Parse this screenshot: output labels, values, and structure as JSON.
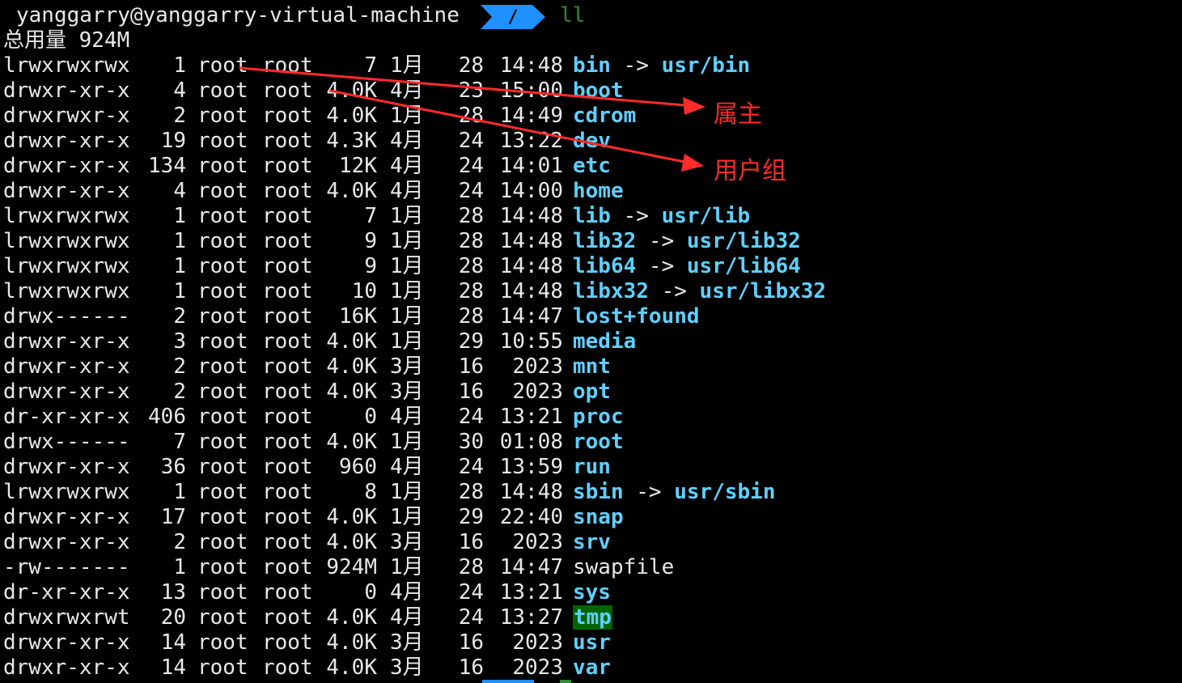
{
  "prompt": {
    "user_host": "yanggarry@yanggarry-virtual-machine",
    "cwd": "/",
    "command": "ll"
  },
  "total_line": "总用量 924M",
  "rows": [
    {
      "perm": "lrwxrwxrwx",
      "links": "1",
      "owner": "root",
      "group": "root",
      "size": "7",
      "month": "1月",
      "day": "28",
      "time": "14:48",
      "name": "bin",
      "target": "usr/bin",
      "style": "bold"
    },
    {
      "perm": "drwxr-xr-x",
      "links": "4",
      "owner": "root",
      "group": "root",
      "size": "4.0K",
      "month": "4月",
      "day": "23",
      "time": "15:00",
      "name": "boot",
      "target": "",
      "style": "bold"
    },
    {
      "perm": "drwxrwxr-x",
      "links": "2",
      "owner": "root",
      "group": "root",
      "size": "4.0K",
      "month": "1月",
      "day": "28",
      "time": "14:49",
      "name": "cdrom",
      "target": "",
      "style": "bold"
    },
    {
      "perm": "drwxr-xr-x",
      "links": "19",
      "owner": "root",
      "group": "root",
      "size": "4.3K",
      "month": "4月",
      "day": "24",
      "time": "13:22",
      "name": "dev",
      "target": "",
      "style": "bold"
    },
    {
      "perm": "drwxr-xr-x",
      "links": "134",
      "owner": "root",
      "group": "root",
      "size": "12K",
      "month": "4月",
      "day": "24",
      "time": "14:01",
      "name": "etc",
      "target": "",
      "style": "bold"
    },
    {
      "perm": "drwxr-xr-x",
      "links": "4",
      "owner": "root",
      "group": "root",
      "size": "4.0K",
      "month": "4月",
      "day": "24",
      "time": "14:00",
      "name": "home",
      "target": "",
      "style": "bold"
    },
    {
      "perm": "lrwxrwxrwx",
      "links": "1",
      "owner": "root",
      "group": "root",
      "size": "7",
      "month": "1月",
      "day": "28",
      "time": "14:48",
      "name": "lib",
      "target": "usr/lib",
      "style": "bold"
    },
    {
      "perm": "lrwxrwxrwx",
      "links": "1",
      "owner": "root",
      "group": "root",
      "size": "9",
      "month": "1月",
      "day": "28",
      "time": "14:48",
      "name": "lib32",
      "target": "usr/lib32",
      "style": "bold"
    },
    {
      "perm": "lrwxrwxrwx",
      "links": "1",
      "owner": "root",
      "group": "root",
      "size": "9",
      "month": "1月",
      "day": "28",
      "time": "14:48",
      "name": "lib64",
      "target": "usr/lib64",
      "style": "bold"
    },
    {
      "perm": "lrwxrwxrwx",
      "links": "1",
      "owner": "root",
      "group": "root",
      "size": "10",
      "month": "1月",
      "day": "28",
      "time": "14:48",
      "name": "libx32",
      "target": "usr/libx32",
      "style": "bold"
    },
    {
      "perm": "drwx------",
      "links": "2",
      "owner": "root",
      "group": "root",
      "size": "16K",
      "month": "1月",
      "day": "28",
      "time": "14:47",
      "name": "lost+found",
      "target": "",
      "style": "bold"
    },
    {
      "perm": "drwxr-xr-x",
      "links": "3",
      "owner": "root",
      "group": "root",
      "size": "4.0K",
      "month": "1月",
      "day": "29",
      "time": "10:55",
      "name": "media",
      "target": "",
      "style": "bold"
    },
    {
      "perm": "drwxr-xr-x",
      "links": "2",
      "owner": "root",
      "group": "root",
      "size": "4.0K",
      "month": "3月",
      "day": "16",
      "time": "2023",
      "name": "mnt",
      "target": "",
      "style": "bold"
    },
    {
      "perm": "drwxr-xr-x",
      "links": "2",
      "owner": "root",
      "group": "root",
      "size": "4.0K",
      "month": "3月",
      "day": "16",
      "time": "2023",
      "name": "opt",
      "target": "",
      "style": "bold"
    },
    {
      "perm": "dr-xr-xr-x",
      "links": "406",
      "owner": "root",
      "group": "root",
      "size": "0",
      "month": "4月",
      "day": "24",
      "time": "13:21",
      "name": "proc",
      "target": "",
      "style": "bold"
    },
    {
      "perm": "drwx------",
      "links": "7",
      "owner": "root",
      "group": "root",
      "size": "4.0K",
      "month": "1月",
      "day": "30",
      "time": "01:08",
      "name": "root",
      "target": "",
      "style": "bold"
    },
    {
      "perm": "drwxr-xr-x",
      "links": "36",
      "owner": "root",
      "group": "root",
      "size": "960",
      "month": "4月",
      "day": "24",
      "time": "13:59",
      "name": "run",
      "target": "",
      "style": "bold"
    },
    {
      "perm": "lrwxrwxrwx",
      "links": "1",
      "owner": "root",
      "group": "root",
      "size": "8",
      "month": "1月",
      "day": "28",
      "time": "14:48",
      "name": "sbin",
      "target": "usr/sbin",
      "style": "bold"
    },
    {
      "perm": "drwxr-xr-x",
      "links": "17",
      "owner": "root",
      "group": "root",
      "size": "4.0K",
      "month": "1月",
      "day": "29",
      "time": "22:40",
      "name": "snap",
      "target": "",
      "style": "bold"
    },
    {
      "perm": "drwxr-xr-x",
      "links": "2",
      "owner": "root",
      "group": "root",
      "size": "4.0K",
      "month": "3月",
      "day": "16",
      "time": "2023",
      "name": "srv",
      "target": "",
      "style": "bold"
    },
    {
      "perm": "-rw-------",
      "links": "1",
      "owner": "root",
      "group": "root",
      "size": "924M",
      "month": "1月",
      "day": "28",
      "time": "14:47",
      "name": "swapfile",
      "target": "",
      "style": "plain"
    },
    {
      "perm": "dr-xr-xr-x",
      "links": "13",
      "owner": "root",
      "group": "root",
      "size": "0",
      "month": "4月",
      "day": "24",
      "time": "13:21",
      "name": "sys",
      "target": "",
      "style": "bold"
    },
    {
      "perm": "drwxrwxrwt",
      "links": "20",
      "owner": "root",
      "group": "root",
      "size": "4.0K",
      "month": "4月",
      "day": "24",
      "time": "13:27",
      "name": "tmp",
      "target": "",
      "style": "highlight"
    },
    {
      "perm": "drwxr-xr-x",
      "links": "14",
      "owner": "root",
      "group": "root",
      "size": "4.0K",
      "month": "3月",
      "day": "16",
      "time": "2023",
      "name": "usr",
      "target": "",
      "style": "bold"
    },
    {
      "perm": "drwxr-xr-x",
      "links": "14",
      "owner": "root",
      "group": "root",
      "size": "4.0K",
      "month": "3月",
      "day": "16",
      "time": "2023",
      "name": "var",
      "target": "",
      "style": "bold"
    }
  ],
  "annotations": {
    "owner_label": "属主",
    "group_label": "用户组",
    "color": "#ff2a2a"
  },
  "colors": {
    "background": "#000000",
    "text": "#e8e8e8",
    "directory": "#5fd0ff",
    "prompt_segment": "#1e90ff",
    "command": "#2e8b2e",
    "sticky_bg": "#006400"
  }
}
